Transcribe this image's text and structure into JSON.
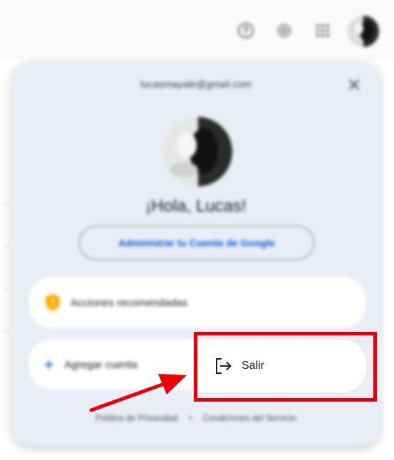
{
  "account_menu": {
    "email": "lucasmayale@gmail.com",
    "greeting": "¡Hola, Lucas!",
    "manage_account_label": "Administrar tu Cuenta de Google",
    "recommended_actions_label": "Acciones recomendadas",
    "add_account_label": "Agregar cuenta",
    "sign_out_label": "Salir",
    "footer": {
      "privacy_label": "Política de Privacidad",
      "separator": "•",
      "terms_label": "Condiciones del Servicio"
    }
  },
  "topbar": {
    "icons": [
      "help-icon",
      "settings-icon",
      "apps-grid-icon"
    ]
  },
  "colors": {
    "accent_blue": "#0b57d0",
    "annotation_red": "#ea0000",
    "panel_background": "#e9eef6",
    "shield_yellow": "#f9ab00"
  }
}
